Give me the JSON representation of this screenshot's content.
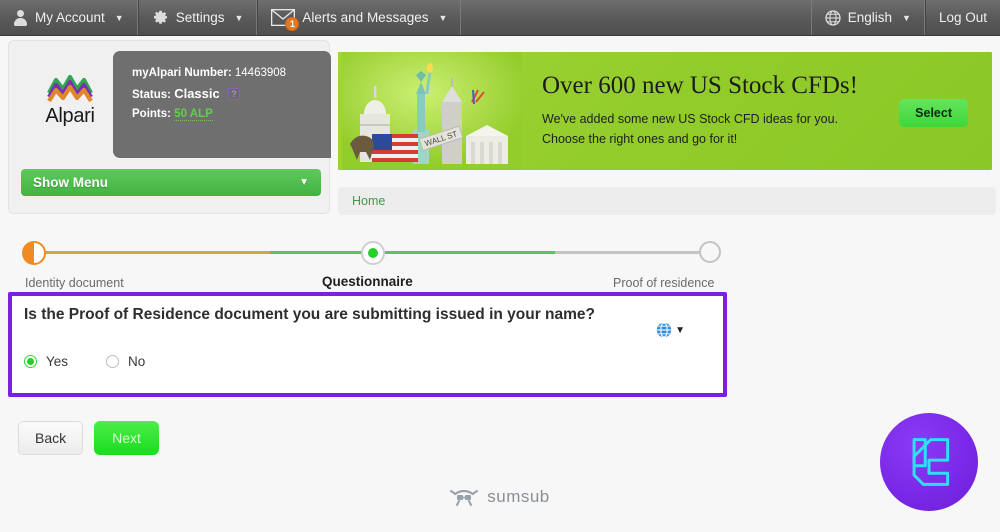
{
  "topbar": {
    "items": [
      {
        "label": "My Account",
        "icon": "person-icon",
        "caret": "▼"
      },
      {
        "label": "Settings",
        "icon": "gear-icon",
        "caret": "▼"
      },
      {
        "label": "Alerts and Messages",
        "icon": "mail-icon",
        "caret": "▼",
        "badge": "1"
      }
    ],
    "language": {
      "label": "English",
      "icon": "globe-icon",
      "caret": "▼"
    },
    "logout_label": "Log Out"
  },
  "account_panel": {
    "brand": "Alpari",
    "number_label": "myAlpari Number:",
    "number_value": "14463908",
    "status_label": "Status:",
    "status_value": "Classic",
    "status_help": "?",
    "points_label": "Points:",
    "points_value": "50 ALP",
    "show_menu_label": "Show Menu",
    "show_menu_caret": "▼"
  },
  "banner": {
    "title": "Over 600 new US Stock CFDs!",
    "line1": "We've added some new US Stock CFD ideas for you.",
    "line2": "Choose the right ones and go for it!",
    "button_label": "Select",
    "bg_color": "#93cd2b"
  },
  "breadcrumb": {
    "home_label": "Home"
  },
  "stepper": {
    "steps": [
      {
        "label": "Identity document",
        "state": "partial",
        "color": "#ef8b22"
      },
      {
        "label": "Questionnaire",
        "state": "active",
        "color": "#25d128"
      },
      {
        "label": "Proof of residence",
        "state": "pending",
        "color": "#c4c4c4"
      }
    ]
  },
  "question": {
    "text": "Is the Proof of Residence document you are submitting issued in your name?",
    "highlight_color": "#7b1fe0",
    "translate_caret": "▼",
    "options": [
      {
        "label": "Yes",
        "selected": true
      },
      {
        "label": "No",
        "selected": false
      }
    ]
  },
  "actions": {
    "back_label": "Back",
    "next_label": "Next"
  },
  "footer": {
    "brand": "sumsub"
  }
}
